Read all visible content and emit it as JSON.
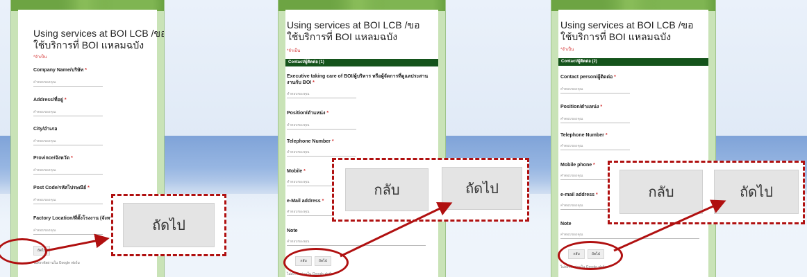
{
  "colors": {
    "accent_red": "#b01010",
    "section_green": "#14531b",
    "frame_green": "#c9e3b7"
  },
  "panels": [
    {
      "title": "Using services at BOI LCB /ขอใช้บริการที่ BOI แหลมฉบัง",
      "required_note": "*จำเป็น",
      "fields": [
        "Company Name/บริษัท",
        "Address/ที่อยู่",
        "City/อำเภอ",
        "Province/จังหวัด",
        "Post Code/รหัสไปรษณีย์",
        "Factory Location/ที่ตั้งโรงงาน (จังหวัด)"
      ],
      "field_placeholder": "คำตอบของคุณ",
      "next_small": "ถัดไป",
      "footer": "ไม่ส่งรหัสผ่านใน Google ฟอร์ม",
      "zoom_next": "ถัดไป"
    },
    {
      "title": "Using services at BOI LCB /ขอใช้บริการที่ BOI แหลมฉบัง",
      "required_note": "*จำเป็น",
      "section": "Contact/ผู้ติดต่อ (1)",
      "fields": [
        "Executive taking care of BOI/ผู้บริหาร หรือผู้จัดการที่ดูแลประสานงานกับ BOI",
        "Position/ตำแหน่ง",
        "Telephone Number",
        "Mobile",
        "e-Mail address",
        "Note"
      ],
      "field_placeholder": "คำตอบของคุณ",
      "back_small": "กลับ",
      "next_small": "ถัดไป",
      "footer": "ไม่ส่งรหัสผ่านใน Google ฟอร์ม",
      "zoom_back": "กลับ",
      "zoom_next": "ถัดไป"
    },
    {
      "title": "Using services at BOI LCB /ขอใช้บริการที่ BOI แหลมฉบัง",
      "required_note": "*จำเป็น",
      "section": "Contact/ผู้ติดต่อ (2)",
      "fields": [
        "Contact person/ผู้ติดต่อ",
        "Position/ตำแหน่ง",
        "Telephone Number",
        "Mobile phone",
        "e-mail address",
        "Note"
      ],
      "field_placeholder": "คำตอบของคุณ",
      "back_small": "กลับ",
      "next_small": "ถัดไป",
      "footer": "ไม่ส่งรหัสผ่านใน Google ฟอร์ม",
      "zoom_back": "กลับ",
      "zoom_next": "ถัดไป"
    }
  ]
}
